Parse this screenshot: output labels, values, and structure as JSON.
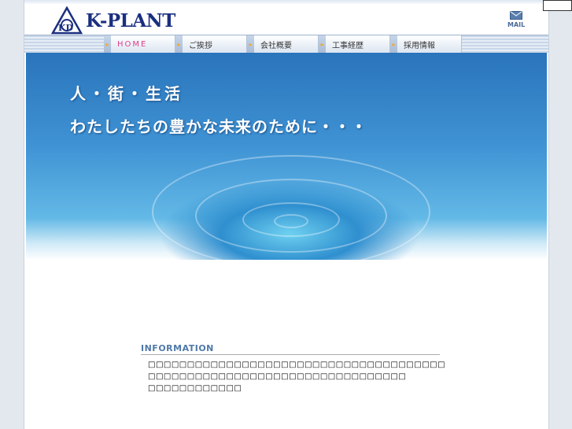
{
  "header": {
    "logo_text": "K-PLANT",
    "mail_label": "MAIL"
  },
  "nav": [
    {
      "label": "HOME"
    },
    {
      "label": "ご挨拶"
    },
    {
      "label": "会社概要"
    },
    {
      "label": "工事経歴"
    },
    {
      "label": "採用情報"
    }
  ],
  "hero": {
    "line1": "人・街・生活",
    "line2": "わたしたちの豊かな未来のために・・・"
  },
  "information": {
    "title": "INFORMATION",
    "lines": [
      "□□□□□□□□□□□□□□□□□□□□□□□□□□□□□□□□□□□□□□",
      "□□□□□□□□□□□□□□□□□□□□□□□□□□□□□□□□□",
      "□□□□□□□□□□□□"
    ]
  }
}
